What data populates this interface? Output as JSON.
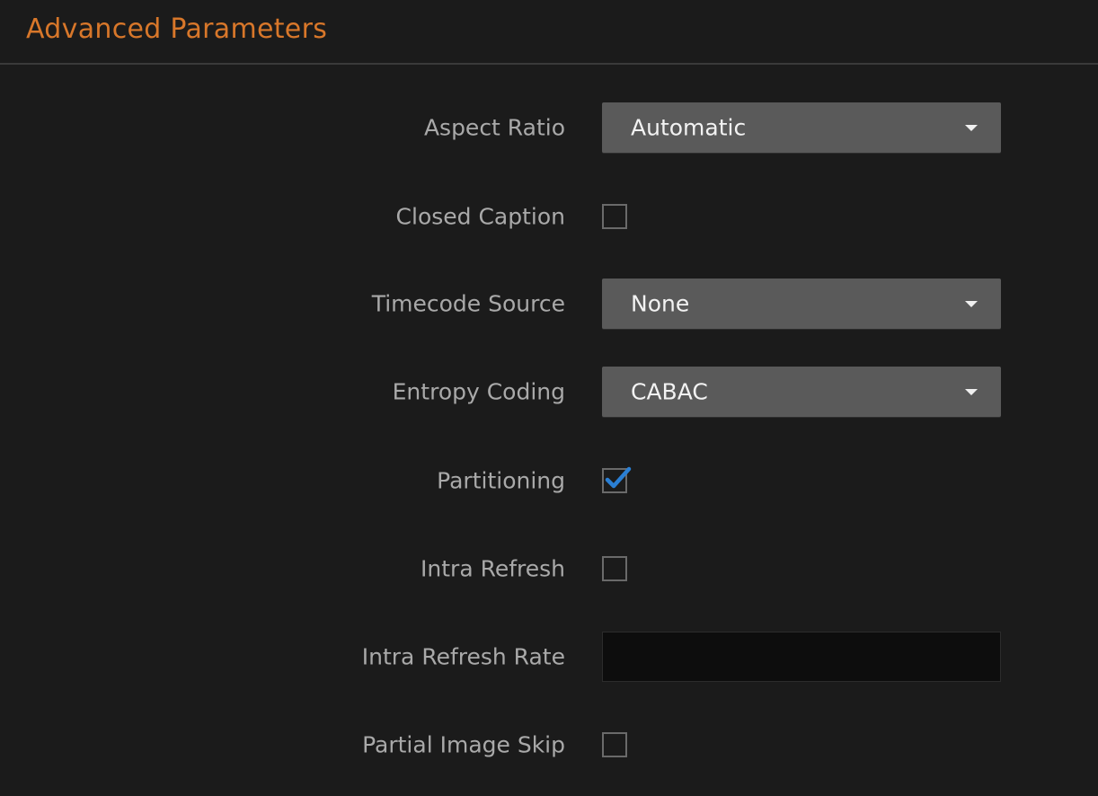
{
  "header": {
    "title": "Advanced Parameters"
  },
  "fields": {
    "aspect_ratio": {
      "label": "Aspect Ratio",
      "value": "Automatic"
    },
    "closed_caption": {
      "label": "Closed Caption",
      "checked": false
    },
    "timecode_source": {
      "label": "Timecode Source",
      "value": "None"
    },
    "entropy_coding": {
      "label": "Entropy Coding",
      "value": "CABAC"
    },
    "partitioning": {
      "label": "Partitioning",
      "checked": true
    },
    "intra_refresh": {
      "label": "Intra Refresh",
      "checked": false
    },
    "intra_refresh_rate": {
      "label": "Intra Refresh Rate",
      "value": ""
    },
    "partial_image_skip": {
      "label": "Partial Image Skip",
      "checked": false
    }
  },
  "colors": {
    "accent": "#d8772a",
    "background": "#1b1b1b",
    "checkmark": "#2a7fd4"
  },
  "icons": {
    "dropdown": "caret-down-icon",
    "check": "checkmark-icon"
  }
}
